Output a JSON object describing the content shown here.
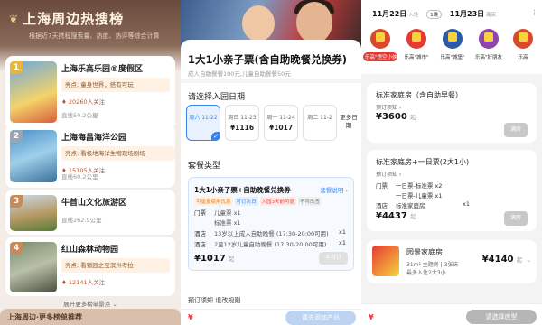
{
  "panel1": {
    "title": "上海周边热搜榜",
    "subtitle": "根据近7天携程搜索量、热度、热评等综合计算",
    "items": [
      {
        "rank": "1",
        "name": "上海乐高乐园®度假区",
        "highlight": "亮点: 童身世界，搭有可玩",
        "heat": "20260人关注",
        "distance": "直线50.2公里"
      },
      {
        "rank": "2",
        "name": "上海海昌海洋公园",
        "highlight": "亮点: 看极地海洋生物现场剧场",
        "heat": "15105人关注",
        "distance": "直线60.2公里"
      },
      {
        "rank": "3",
        "name": "牛首山文化旅游区",
        "highlight": "",
        "heat": "",
        "distance": "直线262.9公里"
      },
      {
        "rank": "4",
        "name": "红山森林动物园",
        "highlight": "亮点: 看锁园之宝滨州考拉",
        "heat": "12141人关注",
        "distance": "直线262.9公里"
      }
    ],
    "more": "展开更多榜单景点",
    "bottom_title": "上海周边·更多榜单推荐"
  },
  "panel2": {
    "product_title": "1大1小亲子票(含自助晚餐兑换券)",
    "product_desc": "成人自助餐餐100元,儿童自助餐餐50元",
    "date_section": "请选择入园日期",
    "dates": [
      {
        "label": "周六 11-22",
        "price": ""
      },
      {
        "label": "周日 11-23",
        "price": "¥1116"
      },
      {
        "label": "周一 11-24",
        "price": "¥1017"
      },
      {
        "label": "周二 11-2",
        "price": ""
      }
    ],
    "more_dates": "更多日期",
    "package_section": "套餐类型",
    "package": {
      "title": "1大1小亲子票+自助晚餐兑换券",
      "link": "套餐说明 ›",
      "tags": [
        "可重复使用优惠",
        "可订次日",
        "入园3天前可退",
        "不可改签"
      ],
      "rows": [
        {
          "k": "门票",
          "v": "儿童票 x1",
          "q": ""
        },
        {
          "k": "",
          "v": "标准票 x1",
          "q": ""
        },
        {
          "k": "酒店",
          "v": "13岁以上成人自助晚餐 (17:30-20:00可用)",
          "q": "x1"
        },
        {
          "k": "酒店",
          "v": "2至12岁儿童自助晚餐 (17:30-20:00可用)",
          "q": "x1"
        }
      ],
      "price": "¥1017",
      "price_suffix": "起",
      "button": "不可订"
    },
    "notice": "预订须知   退改规则",
    "footer_symbol": "¥",
    "footer_button": "请先添加产品"
  },
  "panel3": {
    "checkin": "11月22日",
    "checkin_tag": "入住",
    "nights": "1晚",
    "checkout": "11月23日",
    "checkout_tag": "离店",
    "filters": [
      {
        "label": "乐高\"悟空小侠\"",
        "selected": true,
        "color": "#d84a2c"
      },
      {
        "label": "乐高\"城市\"",
        "selected": false,
        "color": "#e53935"
      },
      {
        "label": "乐高\"城堡\"",
        "selected": false,
        "color": "#2a5aa8"
      },
      {
        "label": "乐高\"好朋友",
        "selected": false,
        "color": "#8e44ad"
      },
      {
        "label": "乐高",
        "selected": false,
        "color": "#d84a2c"
      }
    ],
    "room1": {
      "title": "标准家庭房（含自助早餐）",
      "tag": "预订须知 ›",
      "price": "¥3600",
      "price_suffix": "起",
      "button": "满房"
    },
    "room2": {
      "title": "标准家庭房+一日票(2大1小)",
      "tag": "预订须知 ›",
      "rows": [
        {
          "k": "门票",
          "v": "一日票-标准票 x2"
        },
        {
          "k": "",
          "v": "一日票-儿童票 x1"
        },
        {
          "k": "酒店",
          "v": "标准家庭房",
          "q": "x1"
        }
      ],
      "price": "¥4437",
      "price_suffix": "起",
      "button": "满房"
    },
    "room3": {
      "title": "园景家庭房",
      "size": "31m²  主题房 | 3张床",
      "occupancy": "最多入住2大3小",
      "price": "¥4140",
      "price_suffix": "起"
    },
    "footer_symbol": "¥",
    "footer_button": "请选择房型"
  }
}
